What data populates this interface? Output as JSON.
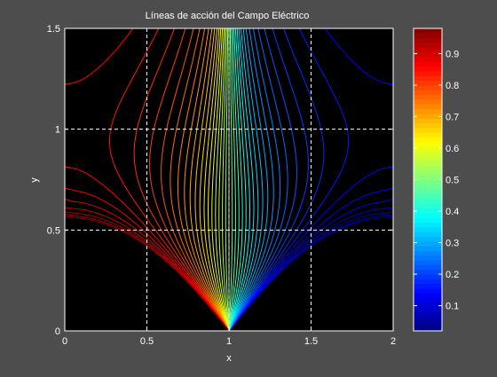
{
  "chart_data": {
    "type": "contour",
    "title": "Líneas de acción del Campo Eléctrico",
    "xlabel": "x",
    "ylabel": "y",
    "xlim": [
      0,
      2
    ],
    "ylim": [
      0,
      1.5
    ],
    "xticks": [
      {
        "value": 0,
        "label": "0"
      },
      {
        "value": 0.5,
        "label": "0.5"
      },
      {
        "value": 1,
        "label": "1"
      },
      {
        "value": 1.5,
        "label": "1.5"
      },
      {
        "value": 2,
        "label": "2"
      }
    ],
    "yticks": [
      {
        "value": 0,
        "label": "0"
      },
      {
        "value": 0.5,
        "label": "0.5"
      },
      {
        "value": 1,
        "label": "1"
      },
      {
        "value": 1.5,
        "label": "1.5"
      }
    ],
    "grid": "dashed",
    "colormap": "jet",
    "background": "#000000",
    "contour_levels": {
      "min": 0.02,
      "max": 0.98,
      "count": 49
    },
    "colorbar": {
      "range": [
        0.02,
        0.98
      ],
      "ticks": [
        {
          "value": 0.1,
          "label": "0.1"
        },
        {
          "value": 0.2,
          "label": "0.2"
        },
        {
          "value": 0.3,
          "label": "0.3"
        },
        {
          "value": 0.4,
          "label": "0.4"
        },
        {
          "value": 0.5,
          "label": "0.5"
        },
        {
          "value": 0.6,
          "label": "0.6"
        },
        {
          "value": 0.7,
          "label": "0.7"
        },
        {
          "value": 0.8,
          "label": "0.8"
        },
        {
          "value": 0.9,
          "label": "0.9"
        }
      ]
    }
  }
}
